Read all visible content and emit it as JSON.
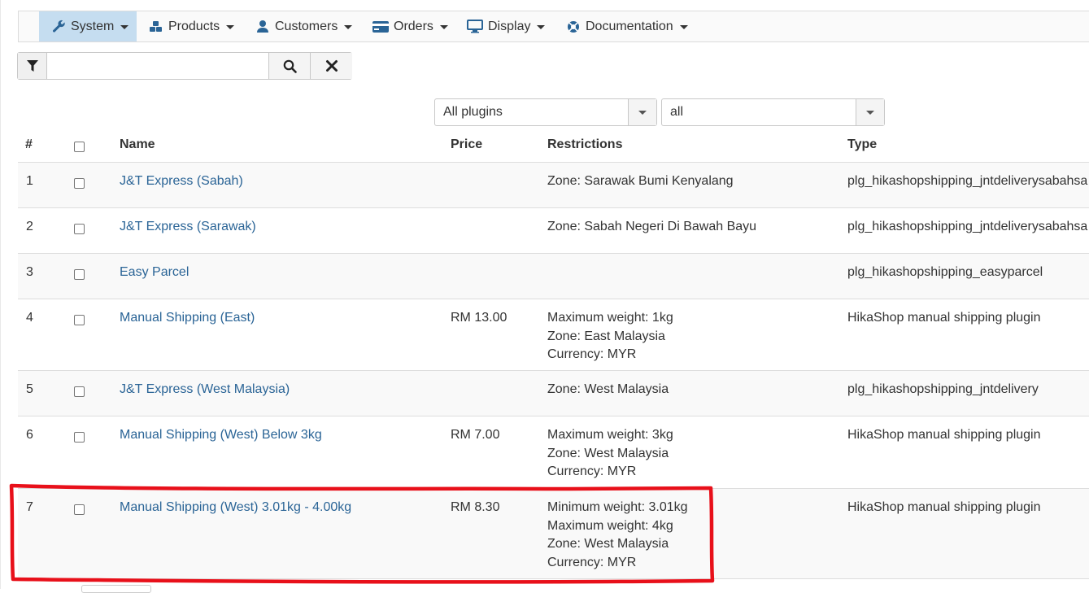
{
  "menu": {
    "items": [
      {
        "label": "System",
        "icon": "wrench-icon"
      },
      {
        "label": "Products",
        "icon": "cubes-icon"
      },
      {
        "label": "Customers",
        "icon": "user-icon"
      },
      {
        "label": "Orders",
        "icon": "credit-card-icon"
      },
      {
        "label": "Display",
        "icon": "monitor-icon"
      },
      {
        "label": "Documentation",
        "icon": "lifebuoy-icon"
      }
    ],
    "active": "System"
  },
  "search": {
    "value": "",
    "placeholder": ""
  },
  "filters": {
    "plugins": "All plugins",
    "published": "all"
  },
  "table": {
    "headers": {
      "num": "#",
      "name": "Name",
      "price": "Price",
      "restrictions": "Restrictions",
      "type": "Type"
    },
    "rows": [
      {
        "num": "1",
        "name": "J&T Express (Sabah)",
        "price": "",
        "restrictions": [
          "Zone: Sarawak Bumi Kenyalang"
        ],
        "type": "plg_hikashopshipping_jntdeliverysabahsa"
      },
      {
        "num": "2",
        "name": "J&T Express (Sarawak)",
        "price": "",
        "restrictions": [
          "Zone: Sabah Negeri Di Bawah Bayu"
        ],
        "type": "plg_hikashopshipping_jntdeliverysabahsa"
      },
      {
        "num": "3",
        "name": "Easy Parcel",
        "price": "",
        "restrictions": [],
        "type": "plg_hikashopshipping_easyparcel"
      },
      {
        "num": "4",
        "name": "Manual Shipping (East)",
        "price": "RM 13.00",
        "restrictions": [
          "Maximum weight: 1kg",
          "Zone: East Malaysia",
          "Currency: MYR"
        ],
        "type": "HikaShop manual shipping plugin"
      },
      {
        "num": "5",
        "name": "J&T Express (West Malaysia)",
        "price": "",
        "restrictions": [
          "Zone: West Malaysia"
        ],
        "type": "plg_hikashopshipping_jntdelivery"
      },
      {
        "num": "6",
        "name": "Manual Shipping (West) Below 3kg",
        "price": "RM 7.00",
        "restrictions": [
          "Maximum weight: 3kg",
          "Zone: West Malaysia",
          "Currency: MYR"
        ],
        "type": "HikaShop manual shipping plugin"
      },
      {
        "num": "7",
        "name": "Manual Shipping (West) 3.01kg - 4.00kg",
        "price": "RM 8.30",
        "restrictions": [
          "Minimum weight: 3.01kg",
          "Maximum weight: 4kg",
          "Zone: West Malaysia",
          "Currency: MYR"
        ],
        "type": "HikaShop manual shipping plugin"
      }
    ]
  },
  "colors": {
    "link": "#2a6496",
    "active_menu": "#c5ddf0",
    "highlight": "#e8101a"
  }
}
